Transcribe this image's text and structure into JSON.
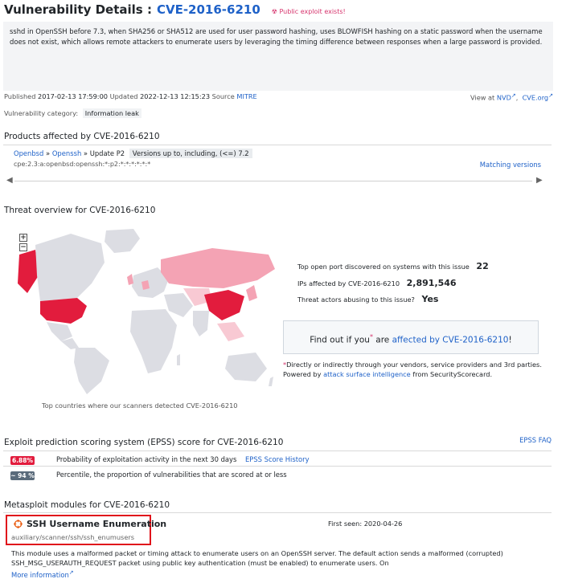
{
  "header": {
    "title": "Vulnerability Details :",
    "cve_id": "CVE-2016-6210",
    "exploit_badge": "Public exploit exists!"
  },
  "summary": "sshd in OpenSSH before 7.3, when SHA256 or SHA512 are used for user password hashing, uses BLOWFISH hashing on a static password when the username does not exist, which allows remote attackers to enumerate users by leveraging the timing difference between responses when a large password is provided.",
  "meta": {
    "published_label": "Published",
    "published": "2017-02-13 17:59:00",
    "updated_label": "Updated",
    "updated": "2022-12-13 12:15:23",
    "source_label": "Source",
    "source": "MITRE",
    "view_at": "View at",
    "nvd": "NVD",
    "cveorg": "CVE.org",
    "category_label": "Vulnerability category:",
    "category": "Information leak"
  },
  "products": {
    "title": "Products affected by CVE-2016-6210",
    "vendor": "Openbsd",
    "sep": "»",
    "product": "Openssh",
    "update_label": "» Update",
    "update": "P2",
    "versions": "Versions up to, including, (<=) 7.2",
    "cpe": "cpe:2.3:a:openbsd:openssh:*:p2:*:*:*:*:*:*",
    "matching": "Matching versions"
  },
  "threat": {
    "title": "Threat overview for CVE-2016-6210",
    "zoom_in": "+",
    "zoom_out": "−",
    "caption": "Top countries where our scanners detected CVE-2016-6210",
    "stats": [
      {
        "label": "Top open port discovered on systems with this issue",
        "value": "22"
      },
      {
        "label": "IPs affected by CVE-2016-6210",
        "value": "2,891,546"
      },
      {
        "label": "Threat actors abusing to this issue?",
        "value": "Yes"
      }
    ],
    "cta_prefix": "Find out if you",
    "cta_star": "*",
    "cta_mid": " are ",
    "cta_link": "affected by CVE-2016-6210",
    "cta_suffix": "!",
    "note_star": "*",
    "note_text": "Directly or indirectly through your vendors, service providers and 3rd parties. Powered by ",
    "note_link": "attack surface intelligence",
    "note_suffix": " from SecurityScorecard.",
    "colors": {
      "land": "#dcdde3",
      "high": "#e21c3d",
      "mid": "#f4a3b4",
      "low": "#f8c9d3"
    }
  },
  "epss": {
    "title": "Exploit prediction scoring system (EPSS) score for CVE-2016-6210",
    "faq": "EPSS FAQ",
    "probability_badge": "6.88%",
    "probability_text": "Probability of exploitation activity in the next 30 days",
    "history": "EPSS Score History",
    "percentile_badge": "~ 94 %",
    "percentile_text": "Percentile, the proportion of vulnerabilities that are scored at or less",
    "badge_colors": {
      "probability": "#e21c3d",
      "percentile": "#5a6b7b"
    }
  },
  "metasploit": {
    "title": "Metasploit modules for CVE-2016-6210",
    "module_name": "SSH Username Enumeration",
    "module_path": "auxiliary/scanner/ssh/ssh_enumusers",
    "first_seen": "First seen: 2020-04-26",
    "description": "This module uses a malformed packet or timing attack to enumerate users on an OpenSSH server. The default action sends a malformed (corrupted) SSH_MSG_USERAUTH_REQUEST packet using public key authentication (must be enabled) to enumerate users. On",
    "more_info": "More information"
  }
}
